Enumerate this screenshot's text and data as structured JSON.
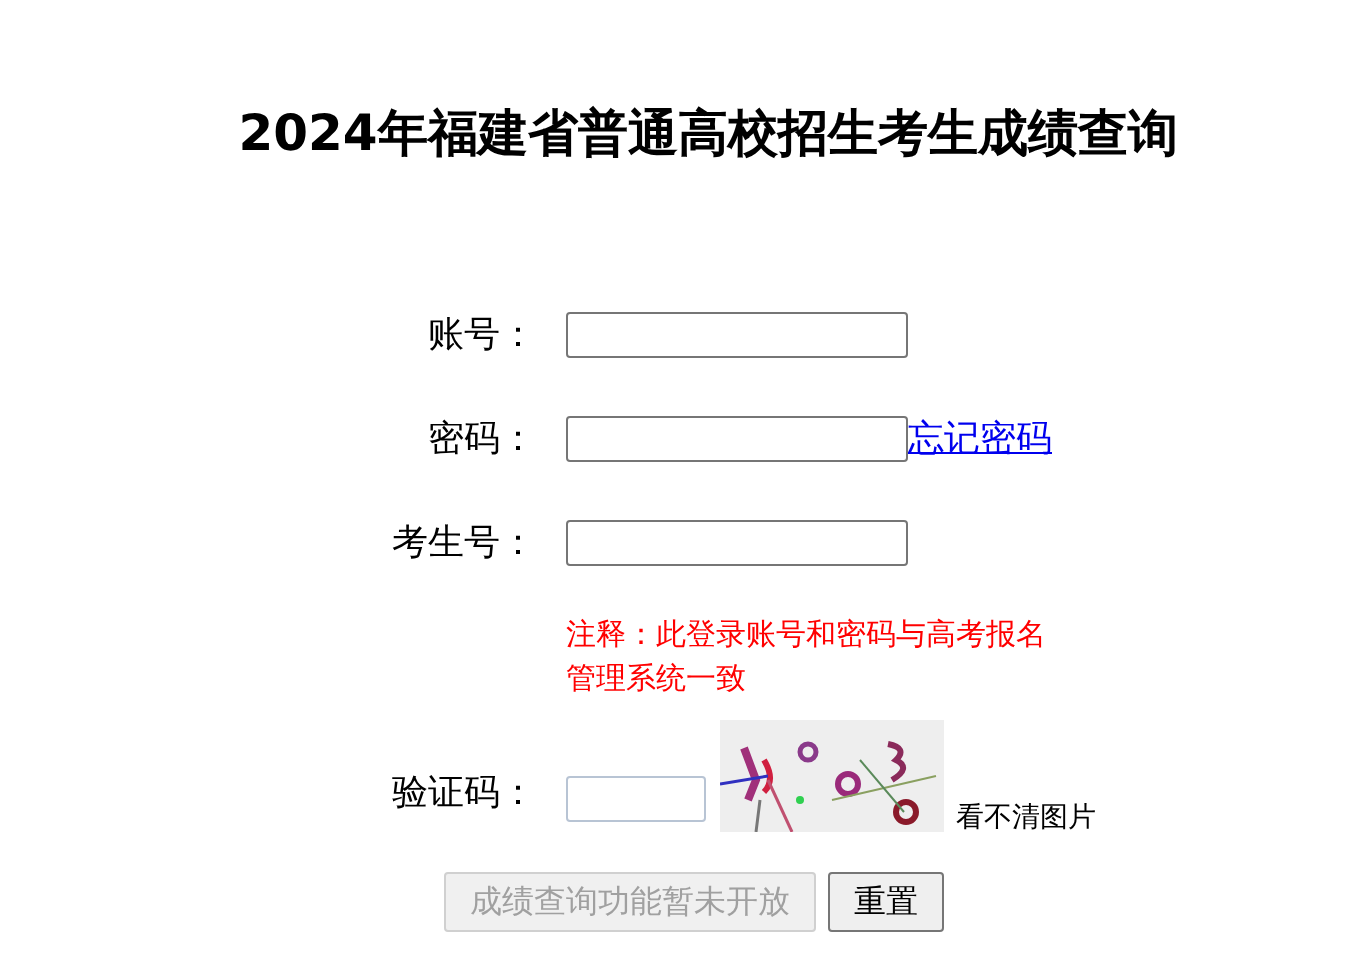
{
  "title": "2024年福建省普通高校招生考生成绩查询",
  "fields": [
    {
      "label": "账号："
    },
    {
      "label": "密码：",
      "link": "忘记密码"
    },
    {
      "label": "考生号：",
      "note": "注释：此登录账号和密码与高考报名管理系统一致"
    }
  ],
  "captcha": {
    "label": "验证码：",
    "refresh": "看不清图片"
  },
  "buttons": [
    {
      "label": "成绩查询功能暂未开放",
      "disabled": true
    },
    {
      "label": "重置",
      "disabled": false
    }
  ]
}
